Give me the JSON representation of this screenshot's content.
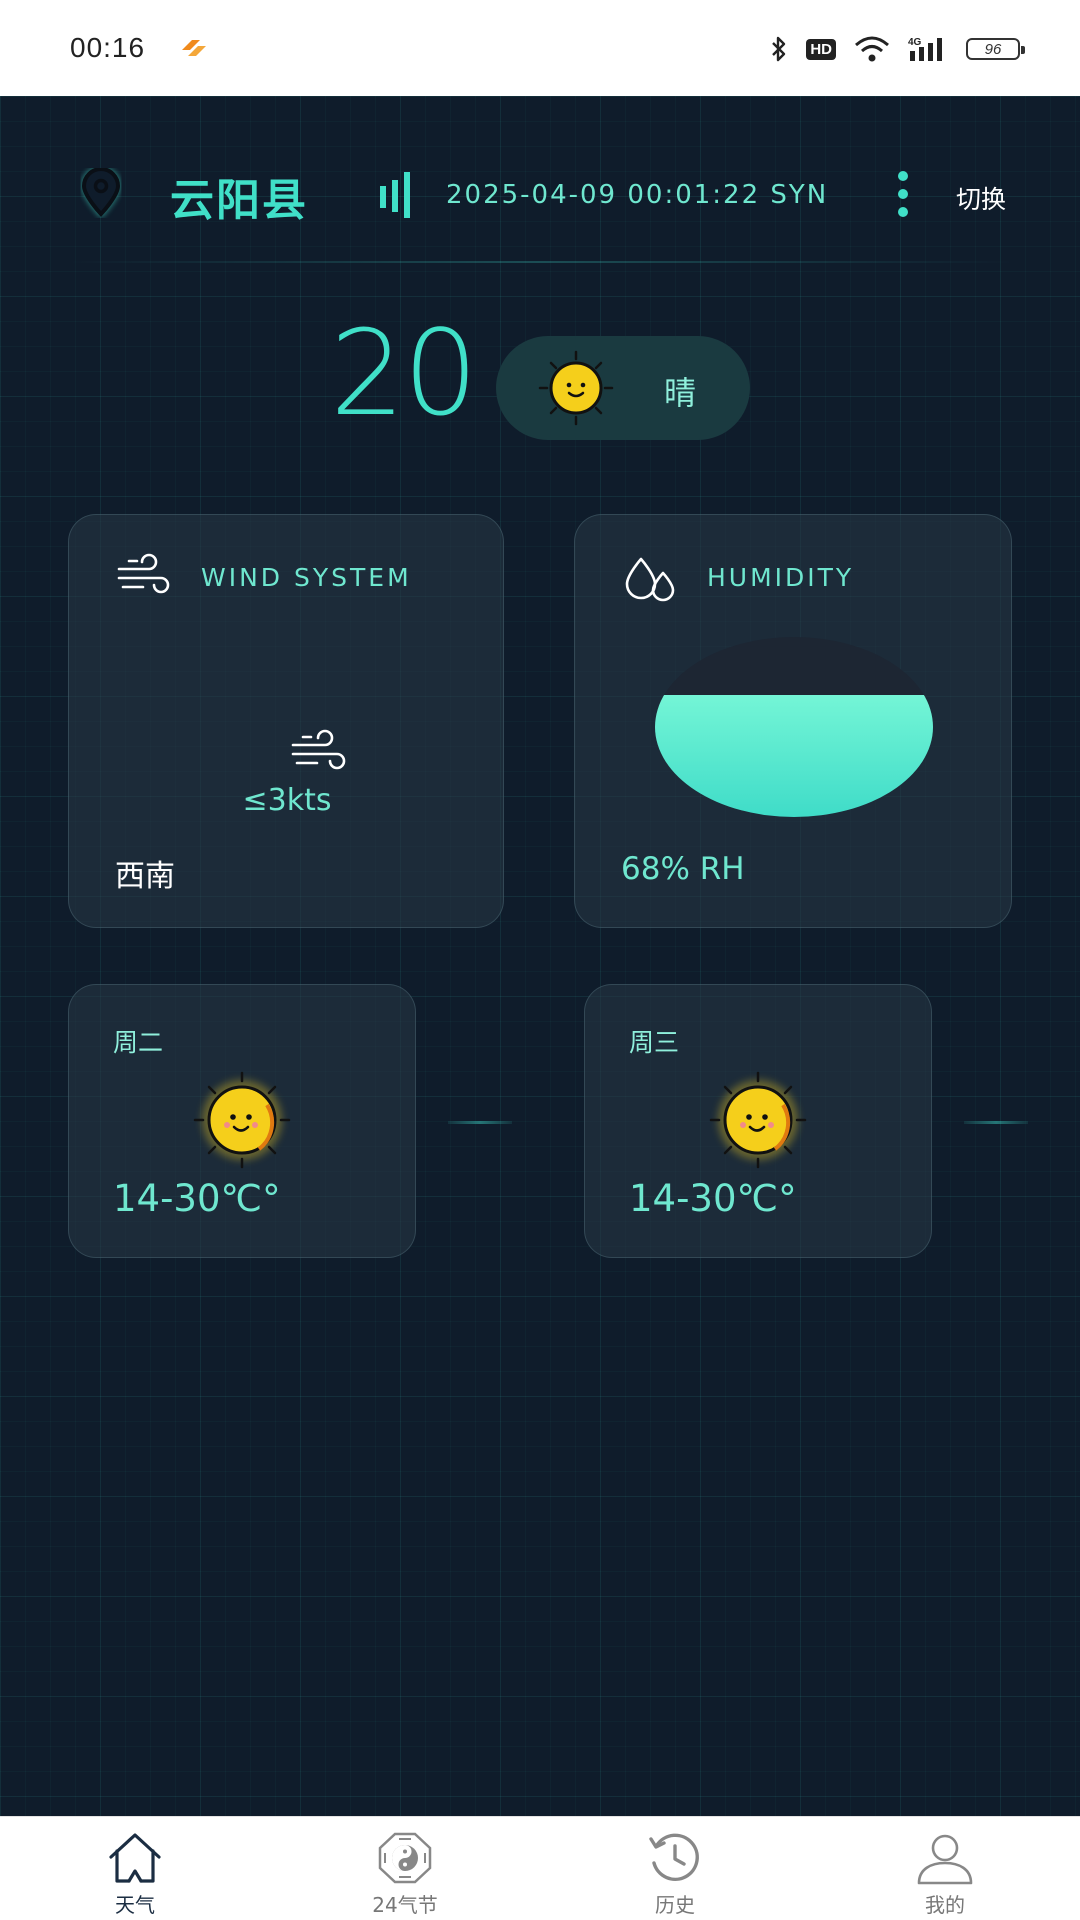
{
  "status_bar": {
    "time": "00:16",
    "battery": "96"
  },
  "header": {
    "city": "云阳县",
    "datetime": "2025-04-09 00:01:22 SYN",
    "switch_label": "切换"
  },
  "current": {
    "temperature": "20",
    "condition": "晴"
  },
  "wind_card": {
    "title": "WIND SYSTEM",
    "speed": "≤3kts",
    "direction": "西南"
  },
  "humidity_card": {
    "title": "HUMIDITY",
    "value": "68% RH",
    "level_fraction": 0.68
  },
  "forecast": [
    {
      "day": "周二",
      "temp_range": "14-30℃°"
    },
    {
      "day": "周三",
      "temp_range": "14-30℃°"
    }
  ],
  "nav": [
    {
      "label": "天气",
      "icon": "home-icon",
      "active": true
    },
    {
      "label": "24气节",
      "icon": "bagua-icon",
      "active": false
    },
    {
      "label": "历史",
      "icon": "history-icon",
      "active": false
    },
    {
      "label": "我的",
      "icon": "user-icon",
      "active": false
    }
  ],
  "colors": {
    "accent": "#40e0c8",
    "background": "#0f1c2b",
    "sun": "#f5cf1b"
  }
}
